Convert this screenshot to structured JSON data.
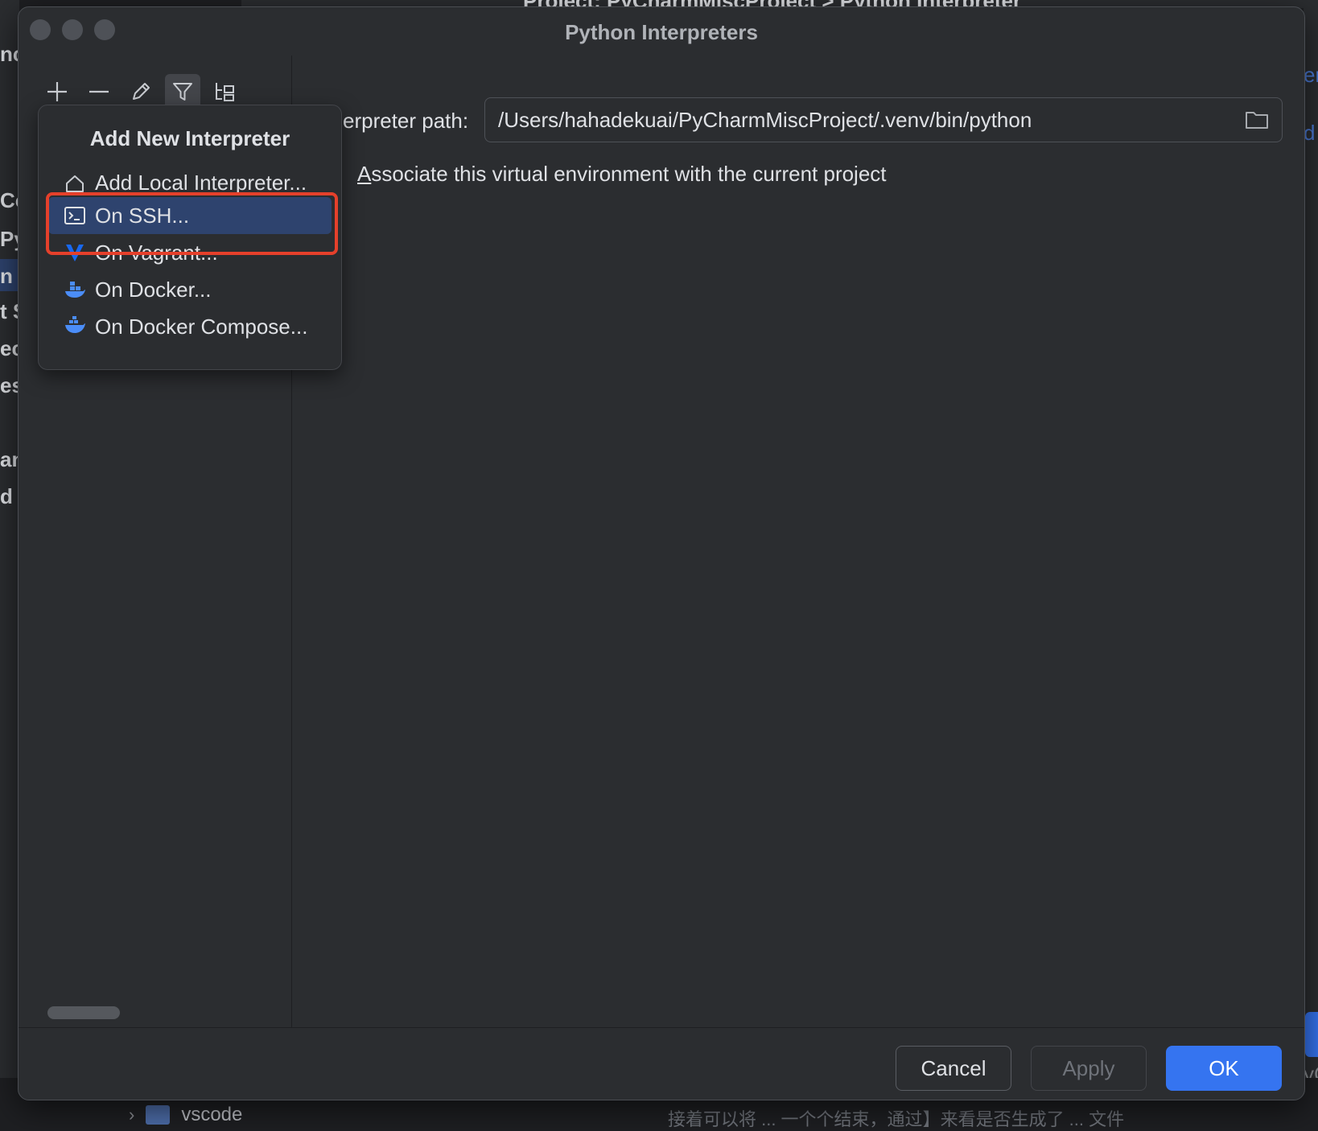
{
  "background": {
    "breadcrumb": "Project: PyCharmMiscProject  >  Python Interpreter",
    "left_fragments": [
      "nc",
      "Co",
      "Py",
      "n I",
      "t S",
      "ec",
      "es",
      "an",
      "d"
    ],
    "right_fragments": [
      "er",
      "d",
      "yC"
    ],
    "tree_item": "vscode",
    "code_line": "接着可以将 ... 一个个结束，通过】来看是否生成了 ... 文件"
  },
  "dialog": {
    "title": "Python Interpreters",
    "toolbar": {
      "add": "plus-icon",
      "remove": "minus-icon",
      "edit": "pencil-icon",
      "filter": "filter-icon",
      "tree": "tree-icon"
    },
    "interpreter_path_label": "erpreter path:",
    "interpreter_path_value": "/Users/hahadekuai/PyCharmMiscProject/.venv/bin/python",
    "associate_label_accel": "A",
    "associate_label_rest": "ssociate this virtual environment with the current project",
    "buttons": {
      "cancel": "Cancel",
      "apply": "Apply",
      "ok": "OK"
    },
    "accent_color": "#3574f0"
  },
  "popup": {
    "title": "Add New Interpreter",
    "items": [
      {
        "label": "Add Local Interpreter...",
        "icon": "home-icon"
      },
      {
        "label": "On SSH...",
        "icon": "terminal-icon",
        "selected": true
      },
      {
        "label": "On Vagrant...",
        "icon": "vagrant-icon"
      },
      {
        "label": "On Docker...",
        "icon": "docker-icon"
      },
      {
        "label": "On Docker Compose...",
        "icon": "docker-compose-icon"
      }
    ],
    "highlight_color": "#e5402b"
  }
}
